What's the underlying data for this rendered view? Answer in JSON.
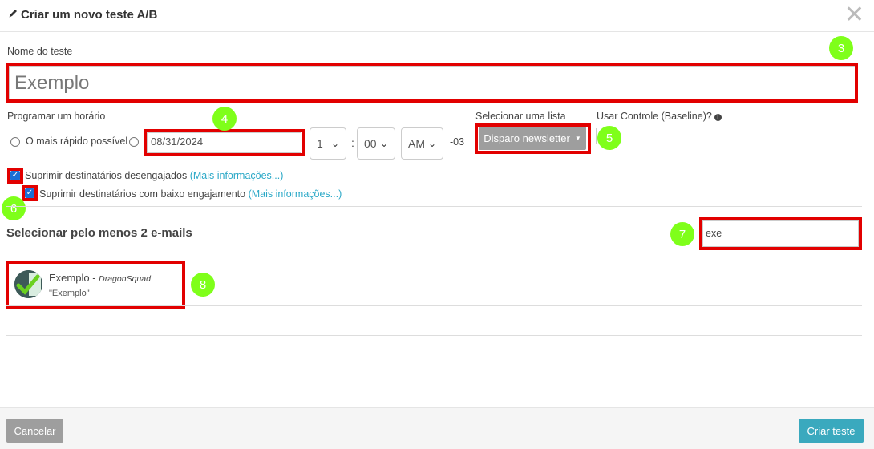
{
  "modal": {
    "title": "Criar um novo teste A/B",
    "close_glyph": "✕"
  },
  "name_section": {
    "label": "Nome do teste",
    "value": "Exemplo"
  },
  "schedule": {
    "label": "Programar um horário",
    "asap_label": "O mais rápido possível",
    "date_value": "08/31/2024",
    "hour": "1",
    "separator": ":",
    "minute": "00",
    "ampm": "AM",
    "timezone": "-03"
  },
  "list_select": {
    "label": "Selecionar uma lista",
    "button_label": "Disparo newsletter"
  },
  "baseline": {
    "label": "Usar Controle (Baseline)?",
    "info_glyph": "i"
  },
  "suppress": {
    "disengaged_label": "Suprimir destinatários desengajados",
    "disengaged_link": "(Mais informações...)",
    "low_engagement_label": "Suprimir destinatários com baixo engajamento",
    "low_engagement_link": "(Mais informações...)"
  },
  "emails": {
    "section_title": "Selecionar pelo menos 2 e-mails",
    "search_value": "exe",
    "items": [
      {
        "name": "Exemplo",
        "separator": " - ",
        "account": "DragonSquad",
        "subject": "\"Exemplo\""
      }
    ]
  },
  "annotations": [
    "3",
    "4",
    "5",
    "6",
    "7",
    "8"
  ],
  "footer": {
    "cancel_label": "Cancelar",
    "create_label": "Criar teste"
  },
  "colors": {
    "highlight": "#e20000",
    "badge": "#7fff1a",
    "link": "#2aa8c7",
    "primary_button": "#3aa9be",
    "secondary_button": "#9e9e9e"
  }
}
